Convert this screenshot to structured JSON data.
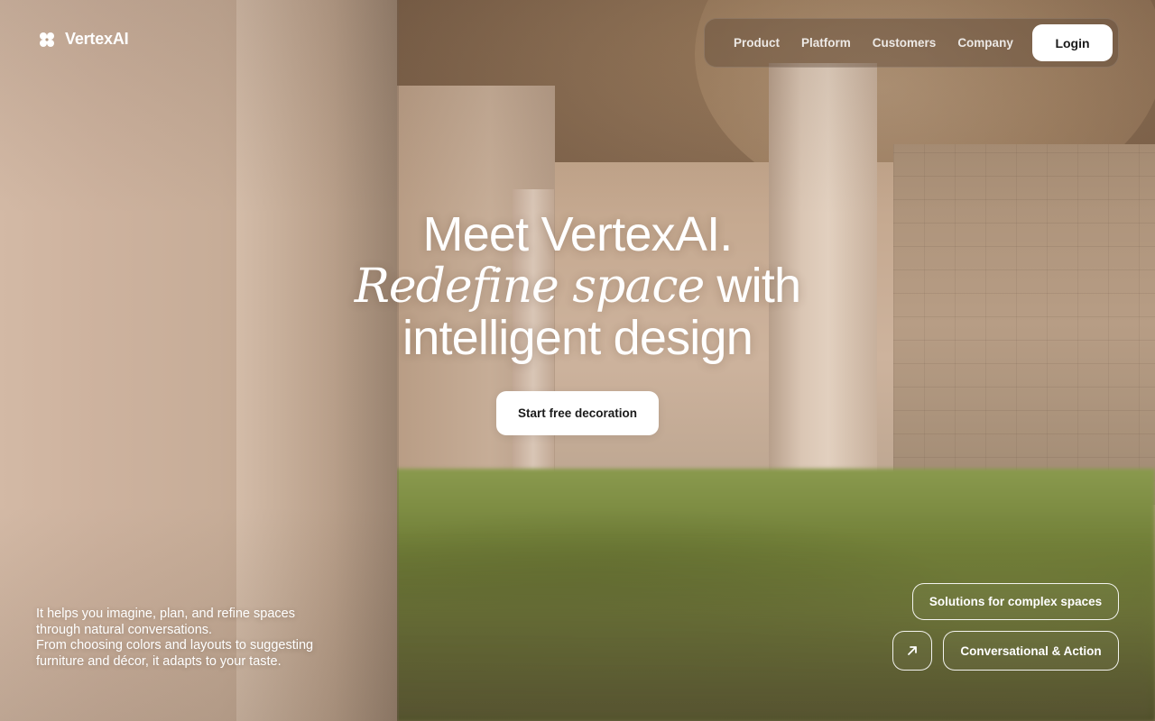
{
  "brand": {
    "name": "VertexAI",
    "logo_icon": "clover-icon"
  },
  "nav": {
    "links": [
      "Product",
      "Platform",
      "Customers",
      "Company"
    ],
    "login_label": "Login"
  },
  "hero": {
    "line1": "Meet VertexAI.",
    "line2_serif": "Redefine space",
    "line2_rest": " with",
    "line3": "intelligent design",
    "cta_label": "Start free decoration"
  },
  "description": {
    "line1": "It helps you imagine, plan, and refine spaces",
    "line2": "through natural conversations.",
    "line3": "From choosing colors and layouts to suggesting",
    "line4": "furniture and décor, it adapts to your taste."
  },
  "chips": {
    "solutions_label": "Solutions for complex spaces",
    "arrow_icon": "arrow-up-right-icon",
    "conversational_label": "Conversational & Action"
  },
  "colors": {
    "text": "#ffffff",
    "button_bg": "#ffffff",
    "button_text": "#1a1a1a",
    "nav_bg": "rgba(90,70,52,0.42)"
  }
}
